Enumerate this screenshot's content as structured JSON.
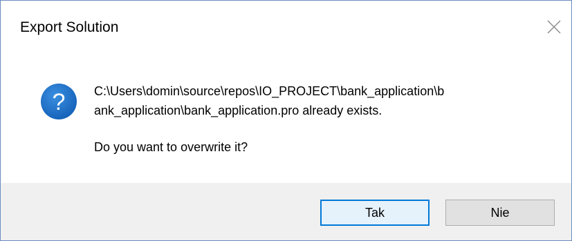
{
  "window": {
    "title": "Export Solution",
    "close_icon": "close-icon"
  },
  "message": {
    "icon": "question-icon",
    "line1": "C:\\Users\\domin\\source\\repos\\IO_PROJECT\\bank_application\\b",
    "line2": "ank_application\\bank_application.pro already exists.",
    "question": "Do you want to overwrite it?"
  },
  "buttons": {
    "yes_label": "Tak",
    "no_label": "Nie"
  },
  "colors": {
    "icon_blue": "#1a6fc4",
    "default_button_border": "#0078d7",
    "footer_bg": "#f0f0f0"
  }
}
